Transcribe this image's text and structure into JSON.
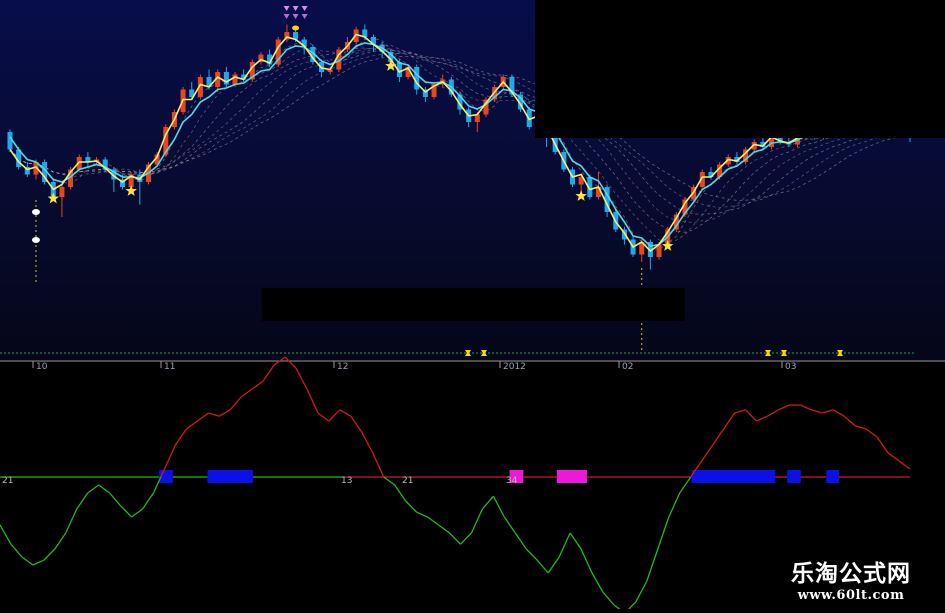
{
  "chart_data": [
    {
      "type": "candlestick",
      "panel": "price",
      "title": "",
      "xlabel": "",
      "ylabel": "",
      "grid": false,
      "time_labels": [
        "10",
        "11",
        "12",
        "2012",
        "02",
        "03"
      ],
      "candles": [
        [
          8.3,
          7.95,
          8.35,
          7.9
        ],
        [
          7.95,
          7.6,
          8.0,
          7.55
        ],
        [
          7.6,
          7.45,
          7.7,
          7.4
        ],
        [
          7.45,
          7.7,
          7.75,
          7.35
        ],
        [
          7.7,
          7.3,
          7.75,
          7.25
        ],
        [
          7.3,
          7.0,
          7.35,
          6.95
        ],
        [
          7.0,
          7.2,
          7.25,
          6.6
        ],
        [
          7.2,
          7.55,
          7.6,
          7.15
        ],
        [
          7.55,
          7.8,
          7.85,
          7.5
        ],
        [
          7.8,
          7.7,
          7.9,
          7.6
        ],
        [
          7.7,
          7.75,
          7.8,
          7.65
        ],
        [
          7.75,
          7.55,
          7.8,
          7.5
        ],
        [
          7.55,
          7.35,
          7.6,
          7.1
        ],
        [
          7.35,
          7.2,
          7.45,
          7.15
        ],
        [
          7.2,
          7.45,
          7.5,
          7.1
        ],
        [
          7.45,
          7.3,
          7.55,
          6.85
        ],
        [
          7.3,
          7.65,
          7.7,
          7.25
        ],
        [
          7.65,
          7.85,
          7.9,
          7.6
        ],
        [
          7.85,
          8.4,
          8.45,
          7.8
        ],
        [
          8.4,
          8.7,
          8.75,
          8.35
        ],
        [
          8.7,
          9.15,
          9.2,
          8.65
        ],
        [
          9.15,
          9.0,
          9.3,
          8.95
        ],
        [
          9.0,
          9.4,
          9.45,
          8.95
        ],
        [
          9.4,
          9.2,
          9.55,
          9.15
        ],
        [
          9.2,
          9.5,
          9.55,
          9.1
        ],
        [
          9.5,
          9.25,
          9.6,
          9.2
        ],
        [
          9.25,
          9.45,
          9.5,
          9.2
        ],
        [
          9.45,
          9.35,
          9.55,
          9.3
        ],
        [
          9.35,
          9.7,
          9.75,
          9.3
        ],
        [
          9.7,
          9.85,
          9.9,
          9.65
        ],
        [
          9.85,
          9.65,
          9.95,
          9.6
        ],
        [
          9.65,
          10.15,
          10.2,
          9.6
        ],
        [
          10.15,
          10.3,
          10.45,
          10.1
        ],
        [
          10.3,
          10.15,
          10.4,
          10.1
        ],
        [
          10.15,
          10.0,
          10.2,
          9.85
        ],
        [
          10.0,
          9.7,
          10.05,
          9.65
        ],
        [
          9.7,
          9.5,
          9.75,
          9.4
        ],
        [
          9.5,
          9.55,
          9.6,
          9.45
        ],
        [
          9.55,
          9.95,
          10.0,
          9.5
        ],
        [
          9.95,
          10.1,
          10.2,
          9.9
        ],
        [
          10.1,
          10.35,
          10.4,
          10.05
        ],
        [
          10.35,
          10.2,
          10.45,
          10.15
        ],
        [
          10.2,
          10.05,
          10.25,
          9.9
        ],
        [
          10.05,
          9.9,
          10.1,
          9.8
        ],
        [
          9.9,
          9.7,
          9.95,
          9.6
        ],
        [
          9.7,
          9.4,
          9.75,
          9.3
        ],
        [
          9.4,
          9.6,
          9.65,
          9.35
        ],
        [
          9.6,
          9.15,
          9.65,
          9.05
        ],
        [
          9.15,
          9.0,
          9.2,
          8.9
        ],
        [
          9.0,
          9.25,
          9.3,
          8.95
        ],
        [
          9.25,
          9.35,
          9.45,
          9.2
        ],
        [
          9.35,
          9.05,
          9.4,
          9.0
        ],
        [
          9.05,
          8.75,
          9.1,
          8.65
        ],
        [
          8.75,
          8.5,
          8.8,
          8.4
        ],
        [
          8.5,
          8.65,
          8.7,
          8.3
        ],
        [
          8.65,
          8.95,
          9.0,
          8.6
        ],
        [
          8.95,
          9.2,
          9.25,
          8.9
        ],
        [
          9.2,
          9.4,
          9.45,
          9.15
        ],
        [
          9.4,
          9.05,
          9.45,
          9.0
        ],
        [
          9.05,
          8.75,
          9.1,
          8.7
        ],
        [
          8.75,
          8.4,
          8.8,
          8.35
        ],
        [
          8.4,
          8.6,
          8.65,
          8.2
        ],
        [
          8.6,
          8.3,
          8.65,
          8.0
        ],
        [
          8.3,
          7.9,
          8.35,
          7.85
        ],
        [
          7.9,
          7.55,
          7.95,
          7.5
        ],
        [
          7.55,
          7.25,
          7.6,
          7.2
        ],
        [
          7.25,
          7.4,
          7.45,
          7.0
        ],
        [
          7.4,
          7.0,
          7.45,
          6.95
        ],
        [
          7.0,
          7.2,
          7.5,
          6.95
        ],
        [
          7.2,
          6.7,
          7.25,
          6.6
        ],
        [
          6.7,
          6.35,
          6.75,
          6.3
        ],
        [
          6.35,
          6.15,
          6.4,
          6.05
        ],
        [
          6.15,
          5.85,
          6.2,
          5.8
        ],
        [
          5.85,
          6.1,
          6.15,
          5.7
        ],
        [
          6.1,
          5.8,
          6.15,
          5.55
        ],
        [
          5.8,
          6.05,
          6.1,
          5.75
        ],
        [
          6.05,
          6.35,
          6.4,
          6.0
        ],
        [
          6.35,
          6.65,
          6.7,
          6.3
        ],
        [
          6.65,
          6.95,
          7.0,
          6.6
        ],
        [
          6.95,
          7.2,
          7.25,
          6.9
        ],
        [
          7.2,
          7.5,
          7.55,
          7.15
        ],
        [
          7.5,
          7.4,
          7.6,
          7.35
        ],
        [
          7.4,
          7.65,
          7.7,
          7.35
        ],
        [
          7.65,
          7.8,
          7.85,
          7.6
        ],
        [
          7.8,
          7.7,
          7.9,
          7.65
        ],
        [
          7.7,
          7.95,
          8.0,
          7.65
        ],
        [
          7.95,
          8.1,
          8.15,
          7.9
        ],
        [
          8.1,
          8.0,
          8.2,
          7.95
        ],
        [
          8.0,
          8.25,
          8.3,
          7.95
        ],
        [
          8.25,
          8.1,
          8.35,
          8.05
        ],
        [
          8.1,
          8.05,
          8.2,
          8.0
        ],
        [
          8.05,
          8.2,
          8.25,
          8.0
        ],
        [
          8.2,
          8.35,
          8.4,
          8.15
        ],
        [
          8.35,
          8.2,
          8.4,
          8.15
        ],
        [
          8.2,
          8.3,
          8.35,
          8.15
        ],
        [
          8.3,
          8.45,
          8.5,
          8.25
        ],
        [
          8.45,
          8.4,
          8.55,
          8.35
        ],
        [
          8.4,
          8.5,
          8.55,
          8.35
        ],
        [
          8.5,
          8.35,
          8.55,
          8.3
        ],
        [
          8.35,
          8.45,
          8.5,
          8.3
        ],
        [
          8.45,
          8.55,
          8.6,
          8.4
        ],
        [
          8.55,
          8.6,
          8.7,
          8.5
        ],
        [
          8.6,
          8.5,
          8.65,
          8.45
        ],
        [
          8.5,
          8.55,
          8.6,
          8.4
        ],
        [
          8.55,
          8.5,
          8.65,
          8.1
        ]
      ],
      "buy_star_bars": [
        5,
        14,
        44,
        66,
        76
      ],
      "yellow_line": [
        7.95,
        7.7,
        7.55,
        7.6,
        7.4,
        7.15,
        7.25,
        7.5,
        7.7,
        7.7,
        7.72,
        7.58,
        7.42,
        7.3,
        7.42,
        7.35,
        7.6,
        7.8,
        8.25,
        8.55,
        8.95,
        8.95,
        9.25,
        9.2,
        9.4,
        9.3,
        9.4,
        9.35,
        9.6,
        9.75,
        9.68,
        10.0,
        10.2,
        10.15,
        10.02,
        9.78,
        9.58,
        9.55,
        9.85,
        10.02,
        10.25,
        10.2,
        10.05,
        9.92,
        9.75,
        9.5,
        9.58,
        9.28,
        9.1,
        9.22,
        9.3,
        9.12,
        8.85,
        8.62,
        8.65,
        8.88,
        9.1,
        9.3,
        9.1,
        8.85,
        8.55,
        8.62,
        8.4,
        8.05,
        7.72,
        7.4,
        7.45,
        7.15,
        7.2,
        6.85,
        6.5,
        6.28,
        6.0,
        6.1,
        5.92,
        6.05,
        6.3,
        6.58,
        6.88,
        7.1,
        7.4,
        7.4,
        7.58,
        7.75,
        7.72,
        7.88,
        8.05,
        8.02,
        8.2,
        8.12,
        8.08,
        8.18,
        8.3,
        8.22,
        8.28,
        8.4,
        8.4,
        8.47,
        8.38,
        8.43,
        8.52,
        8.57,
        8.52,
        8.54,
        8.52
      ],
      "cyan_line": [
        8.2,
        7.95,
        7.75,
        7.7,
        7.55,
        7.35,
        7.3,
        7.4,
        7.55,
        7.6,
        7.65,
        7.6,
        7.5,
        7.4,
        7.4,
        7.38,
        7.48,
        7.62,
        7.9,
        8.15,
        8.5,
        8.65,
        8.9,
        9.0,
        9.15,
        9.18,
        9.25,
        9.28,
        9.4,
        9.52,
        9.55,
        9.75,
        9.95,
        10.02,
        10.0,
        9.88,
        9.72,
        9.65,
        9.72,
        9.85,
        10.02,
        10.08,
        10.05,
        9.98,
        9.86,
        9.68,
        9.64,
        9.45,
        9.3,
        9.28,
        9.3,
        9.2,
        9.02,
        8.82,
        8.76,
        8.85,
        9.0,
        9.15,
        9.12,
        8.98,
        8.76,
        8.7,
        8.55,
        8.3,
        8.02,
        7.72,
        7.62,
        7.4,
        7.32,
        7.05,
        6.75,
        6.5,
        6.22,
        6.18,
        6.02,
        6.05,
        6.2,
        6.42,
        6.68,
        6.9,
        7.15,
        7.25,
        7.4,
        7.56,
        7.62,
        7.75,
        7.9,
        7.95,
        8.08,
        8.1,
        8.08,
        8.14,
        8.23,
        8.22,
        8.25,
        8.34,
        8.37,
        8.43,
        8.4,
        8.42,
        8.48,
        8.53,
        8.52,
        8.53,
        8.52
      ],
      "markers": [
        "top-triangles",
        "bottom-dots",
        "diamond-markers"
      ]
    },
    {
      "type": "line",
      "panel": "indicator",
      "title": "",
      "xlabel": "",
      "ylabel": "",
      "grid": false,
      "baseline": 0,
      "baseline_labels": [
        "21",
        "13",
        "21",
        "34"
      ],
      "series": [
        {
          "color_above": "#d21a1a",
          "color_below": "#22b822",
          "values": [
            -30,
            -42,
            -50,
            -55,
            -52,
            -45,
            -35,
            -20,
            -10,
            -5,
            -10,
            -18,
            -25,
            -20,
            -10,
            5,
            20,
            30,
            35,
            40,
            38,
            42,
            50,
            55,
            60,
            70,
            75,
            68,
            55,
            40,
            35,
            42,
            38,
            28,
            15,
            0,
            -5,
            -15,
            -22,
            -25,
            -30,
            -35,
            -42,
            -35,
            -20,
            -12,
            -25,
            -35,
            -45,
            -52,
            -60,
            -50,
            -35,
            -45,
            -60,
            -72,
            -80,
            -85,
            -78,
            -65,
            -45,
            -25,
            -10,
            0,
            10,
            20,
            30,
            40,
            42,
            35,
            38,
            42,
            45,
            45,
            42,
            40,
            42,
            38,
            32,
            30,
            25,
            15,
            10,
            5
          ]
        }
      ],
      "signal_blocks": [
        {
          "start": 0.175,
          "end": 0.19,
          "color": "#0a10e8"
        },
        {
          "start": 0.228,
          "end": 0.278,
          "color": "#0a10e8"
        },
        {
          "start": 0.56,
          "end": 0.575,
          "color": "#ee18d8"
        },
        {
          "start": 0.612,
          "end": 0.645,
          "color": "#ee18d8"
        },
        {
          "start": 0.76,
          "end": 0.852,
          "color": "#0a10e8"
        },
        {
          "start": 0.865,
          "end": 0.88,
          "color": "#0a10e8"
        },
        {
          "start": 0.908,
          "end": 0.922,
          "color": "#0a10e8"
        }
      ]
    }
  ],
  "watermark": {
    "text": "乐淘公式网",
    "url": "www.60lt.com"
  }
}
